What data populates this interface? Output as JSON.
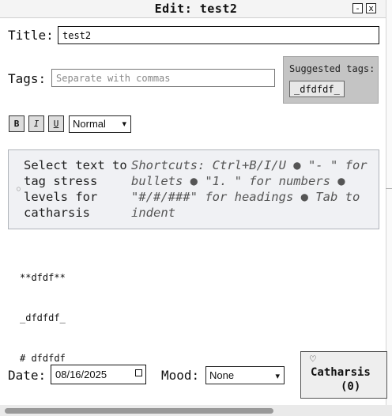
{
  "window": {
    "title": "Edit: test2",
    "minimize_label": "-",
    "close_label": "x"
  },
  "title_field": {
    "label": "Title:",
    "value": "test2"
  },
  "tags_field": {
    "label": "Tags:",
    "placeholder": "Separate with commas",
    "value": ""
  },
  "suggested": {
    "heading": "Suggested tags:",
    "tags": [
      "_dfdfdf_"
    ]
  },
  "toolbar": {
    "bold": "B",
    "italic": "I",
    "underline": "U",
    "style_select": "Normal"
  },
  "hint": {
    "left_text": "Select text to tag stress levels for catharsis",
    "right_text": "Shortcuts: Ctrl+B/I/U ● \"- \" for bullets ● \"1. \" for numbers ● \"#/#/###\" for headings ● Tab to indent"
  },
  "editor": {
    "lines": [
      "**dfdf**",
      "_dfdfdf_",
      "# dfdfdf"
    ]
  },
  "footer": {
    "date_label": "Date:",
    "date_value": "08/16/2025",
    "mood_label": "Mood:",
    "mood_value": "None",
    "catharsis_label": "Catharsis",
    "catharsis_count": "(0)"
  }
}
